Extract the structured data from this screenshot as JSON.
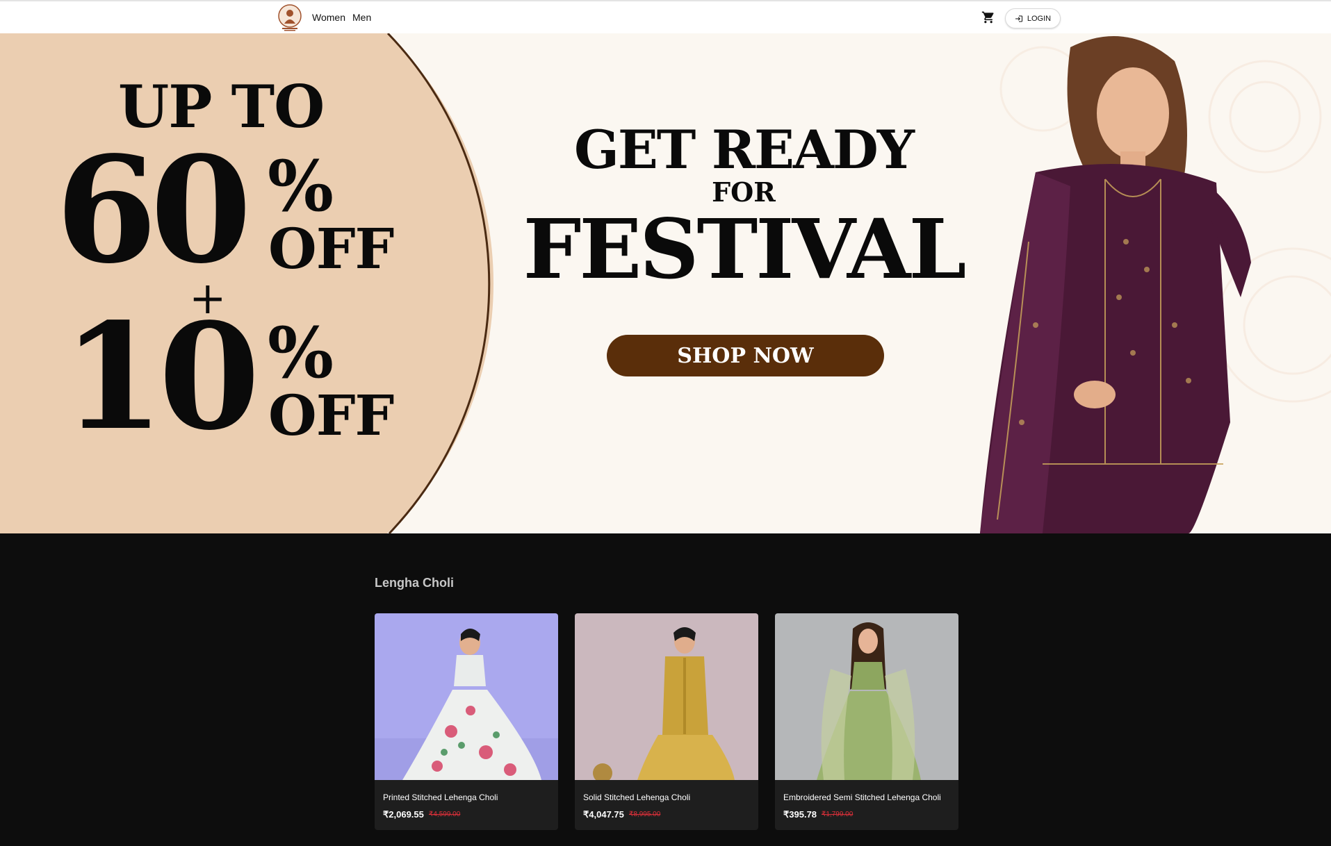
{
  "header": {
    "logo_icon": "hindu-clothes-logo",
    "nav": [
      {
        "label": "Women"
      },
      {
        "label": "Men"
      }
    ],
    "cart_icon": "shopping-cart-icon",
    "login_label": "LOGIN",
    "login_icon": "login-icon"
  },
  "banner": {
    "offer_upto": "UP TO",
    "offer_first_value": "60",
    "offer_percent": "%",
    "offer_off": "OFF",
    "offer_plus": "+",
    "offer_second_value": "10",
    "headline_line1": "GET READY",
    "headline_line2": "FOR",
    "headline_line3": "FESTIVAL",
    "cta_label": "SHOP NOW",
    "colors": {
      "circle": "#ebceb1",
      "background": "#fbf7f1",
      "cta": "#5a2e0a",
      "outfit": "#4a1836"
    }
  },
  "products": {
    "section_title": "Lengha Choli",
    "items": [
      {
        "name": "Printed Stitched Lehenga Choli",
        "price": "₹2,069.55",
        "mrp": "₹4,599.00",
        "image_icon": "floral-lehenga-image"
      },
      {
        "name": "Solid Stitched Lehenga Choli",
        "price": "₹4,047.75",
        "mrp": "₹8,995.00",
        "image_icon": "mustard-lehenga-image"
      },
      {
        "name": "Embroidered Semi Stitched Lehenga Choli",
        "price": "₹395.78",
        "mrp": "₹1,799.00",
        "image_icon": "green-lehenga-image"
      }
    ]
  }
}
